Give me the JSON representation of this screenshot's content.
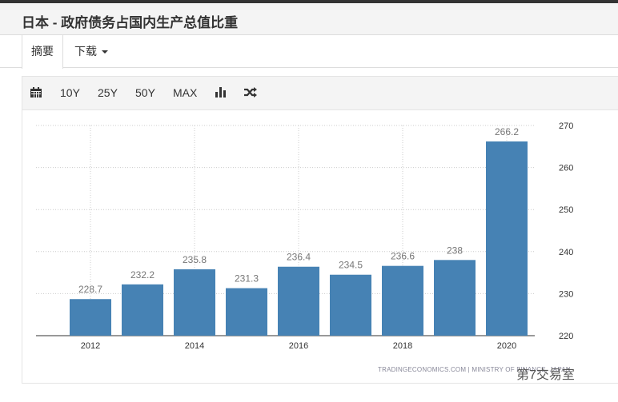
{
  "title": "日本 - 政府债务占国内生产总值比重",
  "tabs": {
    "summary": "摘要",
    "download": "下载"
  },
  "toolbar": {
    "r10": "10Y",
    "r25": "25Y",
    "r50": "50Y",
    "max": "MAX"
  },
  "source": "TRADINGECONOMICS.COM  |  MINISTRY OF FINANCE, JAPAN",
  "watermark": "第7交易室",
  "chart_data": {
    "type": "bar",
    "categories": [
      "2012",
      "2013",
      "2014",
      "2015",
      "2016",
      "2017",
      "2018",
      "2019",
      "2020"
    ],
    "values": [
      228.7,
      232.2,
      235.8,
      231.3,
      236.4,
      234.5,
      236.6,
      238,
      266.2
    ],
    "x_tick_labels": [
      "2012",
      "2014",
      "2016",
      "2018",
      "2020"
    ],
    "y_ticks": [
      220,
      230,
      240,
      250,
      260,
      270
    ],
    "ylim": [
      220,
      270
    ],
    "color": "#4682b4",
    "grid": true,
    "yaxis_position": "right"
  }
}
